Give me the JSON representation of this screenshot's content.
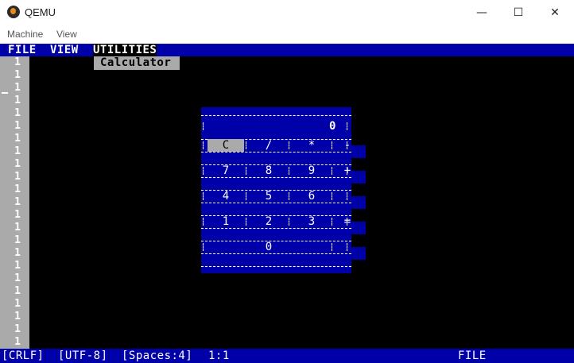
{
  "window": {
    "title": "QEMU",
    "minimize_glyph": "—",
    "maximize_glyph": "☐",
    "close_glyph": "✕"
  },
  "host_menu": [
    "Machine",
    "View"
  ],
  "tm_menu": [
    "FILE",
    "VIEW",
    "UTILITIES"
  ],
  "dropdown": {
    "item": "Calculator"
  },
  "line_numbers": [
    "1",
    "1",
    "1",
    "1",
    "1",
    "1",
    "1",
    "1",
    "1",
    "1",
    "1",
    "1",
    "1",
    "1",
    "1",
    "1",
    "1",
    "1",
    "1",
    "1",
    "1",
    "1",
    "1"
  ],
  "calculator": {
    "display": "0",
    "keys": [
      {
        "label": "C",
        "name": "key-clear",
        "selected": true
      },
      {
        "label": "/",
        "name": "key-divide"
      },
      {
        "label": "*",
        "name": "key-multiply"
      },
      {
        "label": "-",
        "name": "key-minus"
      },
      {
        "label": "7",
        "name": "key-7"
      },
      {
        "label": "8",
        "name": "key-8"
      },
      {
        "label": "9",
        "name": "key-9"
      },
      {
        "label": "+",
        "name": "key-plus"
      },
      {
        "label": "4",
        "name": "key-4"
      },
      {
        "label": "5",
        "name": "key-5"
      },
      {
        "label": "6",
        "name": "key-6"
      },
      {
        "label": "1",
        "name": "key-1"
      },
      {
        "label": "2",
        "name": "key-2"
      },
      {
        "label": "3",
        "name": "key-3"
      },
      {
        "label": "=",
        "name": "key-equals"
      },
      {
        "label": "0",
        "name": "key-0"
      }
    ]
  },
  "status": {
    "line_ending": "[CRLF]",
    "encoding": "[UTF-8]",
    "indent": "[Spaces:4]",
    "position": "1:1",
    "mode": "FILE"
  },
  "colors": {
    "dos_blue": "#0000a8",
    "dos_gray": "#aaaaaa",
    "dos_white": "#ffffff"
  }
}
